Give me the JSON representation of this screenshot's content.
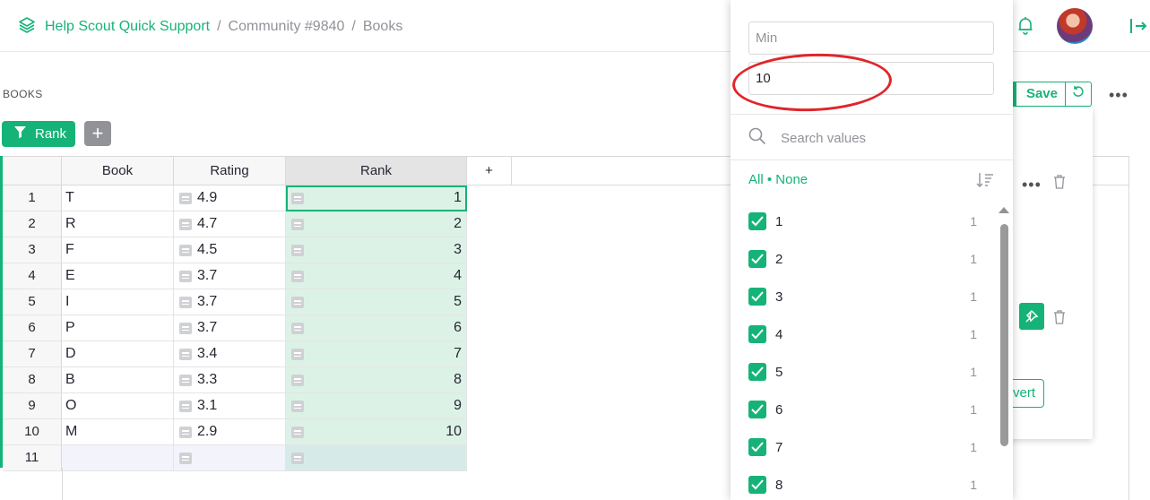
{
  "breadcrumb": {
    "home": "Help Scout Quick Support",
    "sep1": "/",
    "doc": "Community #9840",
    "sep2": "/",
    "page": "Books"
  },
  "section": {
    "title": "BOOKS",
    "filter_button": "Rank",
    "add_button": "+"
  },
  "grid": {
    "columns": [
      "Book",
      "Rating",
      "Rank",
      "+"
    ],
    "rows": [
      {
        "n": "1",
        "book": "T",
        "rating": "4.9",
        "rank": "1"
      },
      {
        "n": "2",
        "book": "R",
        "rating": "4.7",
        "rank": "2"
      },
      {
        "n": "3",
        "book": "F",
        "rating": "4.5",
        "rank": "3"
      },
      {
        "n": "4",
        "book": "E",
        "rating": "3.7",
        "rank": "4"
      },
      {
        "n": "5",
        "book": "I",
        "rating": "3.7",
        "rank": "5"
      },
      {
        "n": "6",
        "book": "P",
        "rating": "3.7",
        "rank": "6"
      },
      {
        "n": "7",
        "book": "D",
        "rating": "3.4",
        "rank": "7"
      },
      {
        "n": "8",
        "book": "B",
        "rating": "3.3",
        "rank": "8"
      },
      {
        "n": "9",
        "book": "O",
        "rating": "3.1",
        "rank": "9"
      },
      {
        "n": "10",
        "book": "M",
        "rating": "2.9",
        "rank": "10"
      },
      {
        "n": "11",
        "book": "",
        "rating": "",
        "rank": ""
      }
    ]
  },
  "filter_dropdown": {
    "min_placeholder": "Min",
    "max_value": "10",
    "search_placeholder": "Search values",
    "all_label": "All",
    "bullet": "•",
    "none_label": "None",
    "values": [
      {
        "value": "1",
        "count": "1"
      },
      {
        "value": "2",
        "count": "1"
      },
      {
        "value": "3",
        "count": "1"
      },
      {
        "value": "4",
        "count": "1"
      },
      {
        "value": "5",
        "count": "1"
      },
      {
        "value": "6",
        "count": "1"
      },
      {
        "value": "7",
        "count": "1"
      },
      {
        "value": "8",
        "count": "1"
      }
    ]
  },
  "right_panel": {
    "save_label": "Save",
    "revert_label": "vert",
    "more": "•••"
  },
  "colors": {
    "accent": "#16b378",
    "annotation": "#e0252a"
  }
}
